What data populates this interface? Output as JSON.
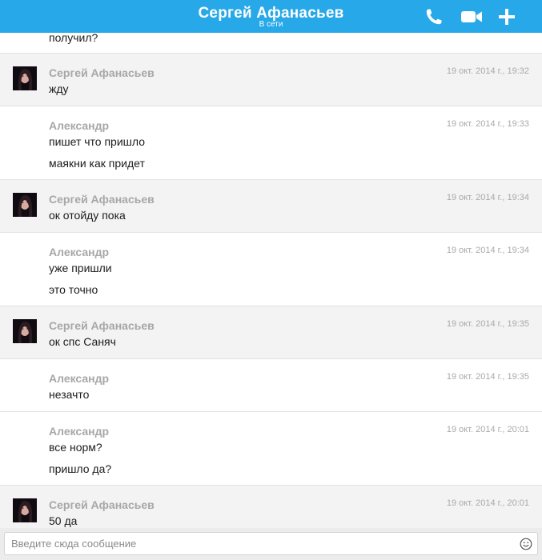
{
  "header": {
    "title": "Сергей Афанасьев",
    "status": "В сети",
    "accent_color": "#27a8e8",
    "actions": [
      "phone-icon",
      "video-camera-icon",
      "plus-icon"
    ]
  },
  "messages": [
    {
      "author": "",
      "time": "",
      "lines": [
        "получил?"
      ]
    },
    {
      "author": "Сергей Афанасьев",
      "time": "19 окт. 2014 г., 19:32",
      "lines": [
        "жду"
      ],
      "has_avatar": true
    },
    {
      "author": "Александр",
      "time": "19 окт. 2014 г., 19:33",
      "lines": [
        "пишет что пришло",
        "маякни как придет"
      ]
    },
    {
      "author": "Сергей Афанасьев",
      "time": "19 окт. 2014 г., 19:34",
      "lines": [
        "ок отойду пока"
      ],
      "has_avatar": true
    },
    {
      "author": "Александр",
      "time": "19 окт. 2014 г., 19:34",
      "lines": [
        "уже пришли",
        "это точно"
      ]
    },
    {
      "author": "Сергей Афанасьев",
      "time": "19 окт. 2014 г., 19:35",
      "lines": [
        "ок спс Саняч"
      ],
      "has_avatar": true
    },
    {
      "author": "Александр",
      "time": "19 окт. 2014 г., 19:35",
      "lines": [
        "незачто"
      ]
    },
    {
      "author": "Александр",
      "time": "19 окт. 2014 г., 20:01",
      "lines": [
        "все норм?",
        "пришло да?"
      ]
    },
    {
      "author": "Сергей Афанасьев",
      "time": "19 окт. 2014 г., 20:01",
      "lines": [
        "50 да"
      ],
      "has_avatar": true
    }
  ],
  "composer": {
    "placeholder": "Введите сюда сообщение",
    "value": ""
  }
}
